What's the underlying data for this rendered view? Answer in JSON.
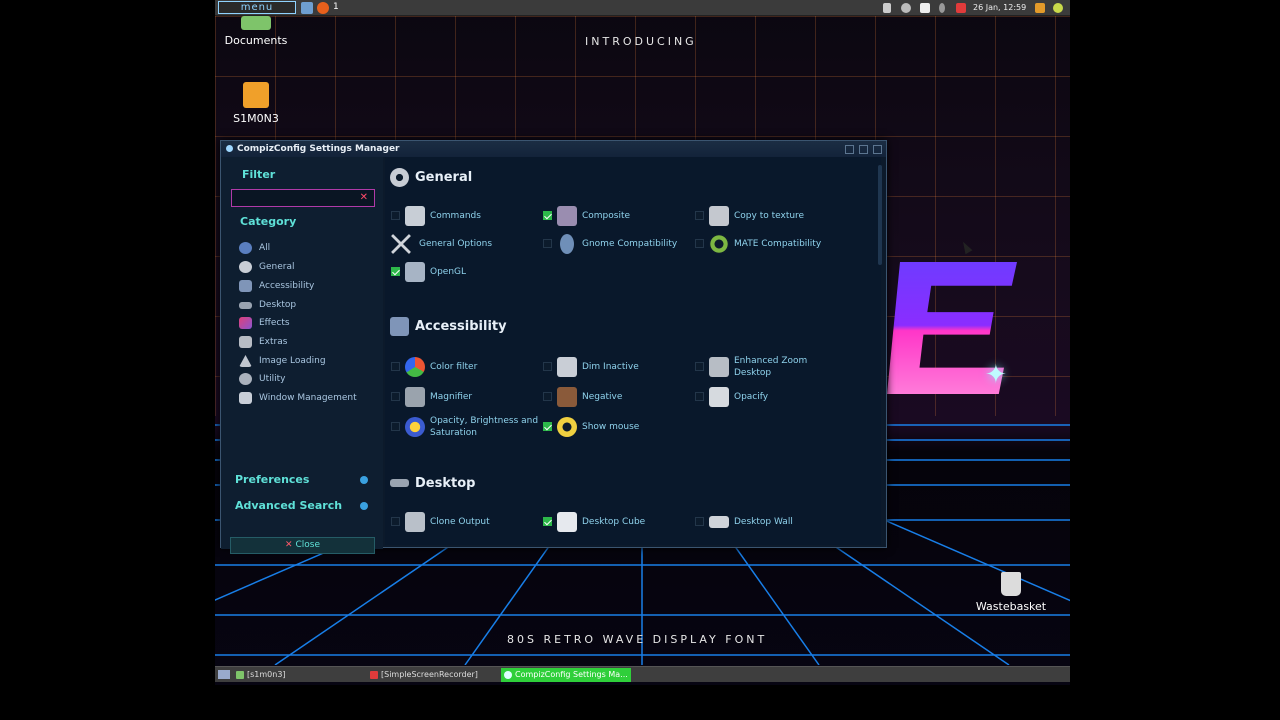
{
  "topbar": {
    "menu_label": "menu",
    "workspace": "1",
    "clock": "26 Jan, 12:59"
  },
  "desktop": {
    "icons": [
      {
        "label": "Documents"
      },
      {
        "label": "S1M0N3"
      },
      {
        "label": "Wastebasket"
      }
    ],
    "overlay_top": "INTRODUCING",
    "overlay_bottom": "80S RETRO WAVE DISPLAY FONT"
  },
  "window": {
    "title": "CompizConfig Settings Manager",
    "sidebar": {
      "filter_heading": "Filter",
      "filter_value": "",
      "category_heading": "Category",
      "categories": [
        {
          "label": "All",
          "icon": "globe-icon"
        },
        {
          "label": "General",
          "icon": "gear-icon"
        },
        {
          "label": "Accessibility",
          "icon": "accessibility-icon"
        },
        {
          "label": "Desktop",
          "icon": "desktop-icon"
        },
        {
          "label": "Effects",
          "icon": "effects-icon"
        },
        {
          "label": "Extras",
          "icon": "extras-icon"
        },
        {
          "label": "Image Loading",
          "icon": "image-loading-icon"
        },
        {
          "label": "Utility",
          "icon": "utility-icon"
        },
        {
          "label": "Window Management",
          "icon": "window-management-icon"
        }
      ],
      "preferences_label": "Preferences",
      "advanced_search_label": "Advanced Search",
      "close_label": "Close"
    },
    "sections": [
      {
        "title": "General",
        "plugins": [
          {
            "label": "Commands",
            "checked": false
          },
          {
            "label": "Composite",
            "checked": true
          },
          {
            "label": "Copy to texture",
            "checked": false
          },
          {
            "label": "General Options",
            "checked": false
          },
          {
            "label": "Gnome Compatibility",
            "checked": false
          },
          {
            "label": "MATE Compatibility",
            "checked": false
          },
          {
            "label": "OpenGL",
            "checked": true
          }
        ]
      },
      {
        "title": "Accessibility",
        "plugins": [
          {
            "label": "Color filter",
            "checked": false
          },
          {
            "label": "Dim Inactive",
            "checked": false
          },
          {
            "label": "Enhanced Zoom Desktop",
            "checked": false
          },
          {
            "label": "Magnifier",
            "checked": false
          },
          {
            "label": "Negative",
            "checked": false
          },
          {
            "label": "Opacify",
            "checked": false
          },
          {
            "label": "Opacity, Brightness and Saturation",
            "checked": false
          },
          {
            "label": "Show mouse",
            "checked": true
          }
        ]
      },
      {
        "title": "Desktop",
        "plugins": [
          {
            "label": "Clone Output",
            "checked": false
          },
          {
            "label": "Desktop Cube",
            "checked": true
          },
          {
            "label": "Desktop Wall",
            "checked": false
          }
        ]
      }
    ]
  },
  "taskbar": {
    "tasks": [
      {
        "label": "[s1m0n3]"
      },
      {
        "label": "[SimpleScreenRecorder]"
      },
      {
        "label": "CompizConfig Settings Ma..."
      }
    ]
  },
  "colors": {
    "accent": "#5fe1d8",
    "checked": "#2db84a",
    "window_bg": "#09182b",
    "active_task": "#2fcf3a"
  }
}
